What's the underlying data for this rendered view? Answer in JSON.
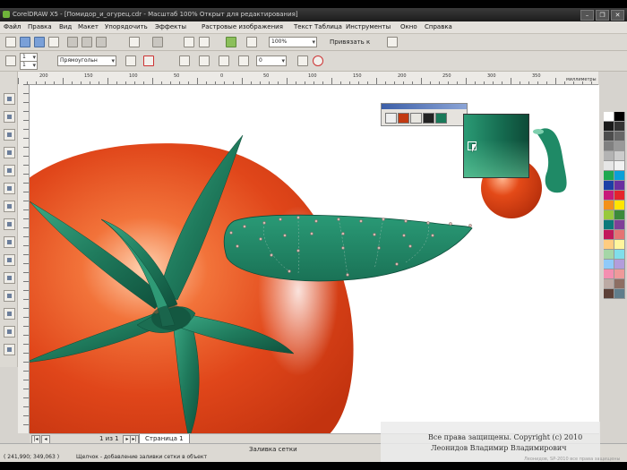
{
  "window": {
    "title": "CorelDRAW X5 - [Помидор_и_огурец.cdr - Масштаб 100% Открыт для редактирования]",
    "controls": [
      "–",
      "❐",
      "✕"
    ]
  },
  "menu": [
    "Файл",
    "Правка",
    "Вид",
    "Макет",
    "Упорядочить",
    "Эффекты",
    "Растровые изображения",
    "Текст",
    "Таблица",
    "Инструменты",
    "Окно",
    "Справка"
  ],
  "toolbar": {
    "zoom_value": "100%",
    "snap_label": "Привязать к"
  },
  "property_bar": {
    "x_value": "1",
    "y_value": "1",
    "mode_value": "Прямоугольн",
    "outline_value": "0"
  },
  "ruler": {
    "units": "миллиметры",
    "ticks": [
      "200",
      "150",
      "100",
      "50",
      "0",
      "50",
      "100",
      "150",
      "200",
      "250",
      "300",
      "350"
    ]
  },
  "palette": {
    "colors": [
      "#ffffff",
      "#000000",
      "#1a1a1a",
      "#333333",
      "#4d4d4d",
      "#666666",
      "#808080",
      "#999999",
      "#b3b3b3",
      "#cccccc",
      "#e6e6e6",
      "#f2f2f2",
      "#1fa84f",
      "#0aa0d8",
      "#1d3fa6",
      "#6b2fa0",
      "#c8197a",
      "#e5242b",
      "#f39019",
      "#ffe500",
      "#98c93c",
      "#3b8a3a",
      "#0c7a7a",
      "#7f3f98",
      "#c2185b",
      "#e57373",
      "#ffcc80",
      "#fff59d",
      "#a5d6a7",
      "#80deea",
      "#90caf9",
      "#b39ddb",
      "#f48fb1",
      "#ef9a9a",
      "#bcaaa4",
      "#8d6e63",
      "#5d4037",
      "#607d8b"
    ]
  },
  "color_widget": {
    "chips": [
      "#c23a12",
      "#e8e6e0",
      "#222222",
      "#1a7a5a"
    ]
  },
  "page_bar": {
    "first": "|◂",
    "prev": "◂",
    "count": "1 из 1",
    "next": "▸",
    "last": "▸|",
    "page_tab": "Страница 1"
  },
  "status": {
    "center": "Заливка сетки",
    "coords": "( 241,990; 349,063 )",
    "hint": "Щелчок - добавление заливки сетки в объект"
  },
  "copyright": {
    "line1": "Все права защищены. Copyright (c) 2010",
    "line2": "Леонидов Владимир Владимирович",
    "line3": "Леонидов, SP-2010 все права защищены"
  }
}
